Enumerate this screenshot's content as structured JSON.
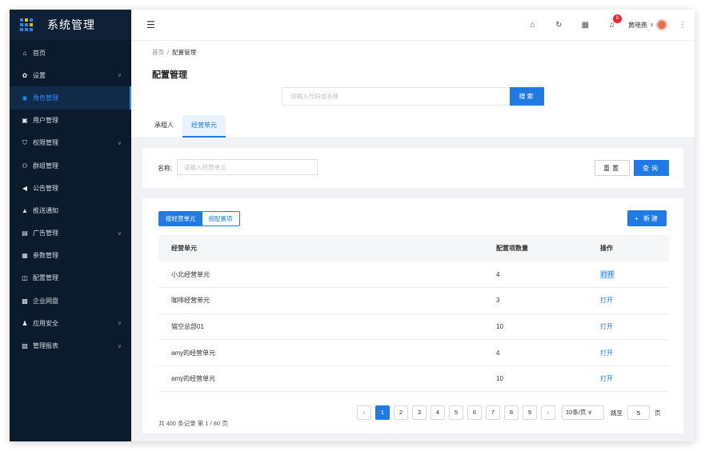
{
  "app": {
    "title": "系统管理"
  },
  "sidebar": {
    "items": [
      {
        "label": "首页",
        "icon": "home-icon",
        "glyph": "⌂",
        "expandable": false,
        "active": false
      },
      {
        "label": "设置",
        "icon": "gear-icon",
        "glyph": "✿",
        "expandable": true,
        "active": false
      },
      {
        "label": "角色管理",
        "icon": "user-circle-icon",
        "glyph": "◉",
        "expandable": false,
        "active": true
      },
      {
        "label": "用户管理",
        "icon": "user-card-icon",
        "glyph": "▣",
        "expandable": false,
        "active": false
      },
      {
        "label": "权限管理",
        "icon": "shield-icon",
        "glyph": "⛉",
        "expandable": true,
        "active": false
      },
      {
        "label": "群组管理",
        "icon": "group-icon",
        "glyph": "⚇",
        "expandable": false,
        "active": false
      },
      {
        "label": "公告管理",
        "icon": "megaphone-icon",
        "glyph": "◀",
        "expandable": false,
        "active": false
      },
      {
        "label": "推送通知",
        "icon": "bell-icon",
        "glyph": "▲",
        "expandable": false,
        "active": false
      },
      {
        "label": "广告管理",
        "icon": "ad-icon",
        "glyph": "▤",
        "expandable": true,
        "active": false
      },
      {
        "label": "参数管理",
        "icon": "params-icon",
        "glyph": "▦",
        "expandable": false,
        "active": false
      },
      {
        "label": "配置管理",
        "icon": "config-icon",
        "glyph": "◫",
        "expandable": false,
        "active": false
      },
      {
        "label": "企业网盘",
        "icon": "drive-icon",
        "glyph": "▩",
        "expandable": false,
        "active": false
      },
      {
        "label": "应用安全",
        "icon": "app-security-icon",
        "glyph": "♟",
        "expandable": true,
        "active": false
      },
      {
        "label": "管理报表",
        "icon": "report-icon",
        "glyph": "▧",
        "expandable": true,
        "active": false
      }
    ]
  },
  "header": {
    "notification_count": "8",
    "username": "黄晓燕"
  },
  "breadcrumb": {
    "home": "首页",
    "current": "配置管理"
  },
  "page": {
    "title": "配置管理"
  },
  "search": {
    "placeholder": "请输入代码或名称",
    "button": "搜索"
  },
  "tabs": [
    {
      "label": "承租人",
      "active": false
    },
    {
      "label": "经营单元",
      "active": true
    }
  ],
  "filter": {
    "label": "名称:",
    "placeholder": "请输入经营单元",
    "reset": "重置",
    "query": "查询"
  },
  "toggle": {
    "left": "按经营单元",
    "right": "按配置项"
  },
  "new_button": "+ 新建",
  "table": {
    "headers": [
      "经营单元",
      "配置项数量",
      "操作"
    ],
    "rows": [
      {
        "unit": "小北经营单元",
        "count": "4",
        "action": "打开"
      },
      {
        "unit": "咖啡经营单元",
        "count": "3",
        "action": "打开"
      },
      {
        "unit": "猫空总部01",
        "count": "10",
        "action": "打开"
      },
      {
        "unit": "amy的经营单元",
        "count": "4",
        "action": "打开"
      },
      {
        "unit": "amy的经营单元",
        "count": "10",
        "action": "打开"
      }
    ]
  },
  "pagination": {
    "summary": "共 400 条记录 第 1 / 80 页",
    "pages": [
      "1",
      "2",
      "3",
      "4",
      "5",
      "6",
      "7",
      "8",
      "9"
    ],
    "current": "1",
    "page_size": "10条/页",
    "jump_label": "跳至",
    "jump_value": "5",
    "jump_unit": "页"
  },
  "colors": {
    "primary": "#1f7ae6",
    "sidebar_bg": "#0b1a2c",
    "badge": "#f5222d"
  }
}
